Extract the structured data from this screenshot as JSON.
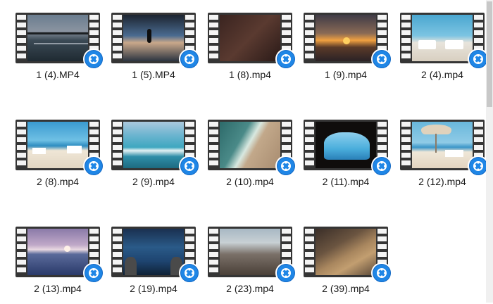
{
  "files": [
    {
      "name": "1 (4).MP4",
      "scene": "pier-sunset"
    },
    {
      "name": "1 (5).MP4",
      "scene": "person-dusk"
    },
    {
      "name": "1 (8).mp4",
      "scene": "dark-sand"
    },
    {
      "name": "1 (9).mp4",
      "scene": "orange-sunset"
    },
    {
      "name": "2 (4).mp4",
      "scene": "sunbeds"
    },
    {
      "name": "2 (8).mp4",
      "scene": "beach-chairs"
    },
    {
      "name": "2 (9).mp4",
      "scene": "turquoise-waves"
    },
    {
      "name": "2 (10).mp4",
      "scene": "aerial-shore"
    },
    {
      "name": "2 (11).mp4",
      "scene": "sea-cave"
    },
    {
      "name": "2 (12).mp4",
      "scene": "beach-umbrella"
    },
    {
      "name": "2 (13).mp4",
      "scene": "purple-sunset"
    },
    {
      "name": "2 (19).mp4",
      "scene": "feet-in-water"
    },
    {
      "name": "2 (23).mp4",
      "scene": "pebbles"
    },
    {
      "name": "2 (39).mp4",
      "scene": "sand-dusk"
    }
  ],
  "badge_icon": "video-player-icon",
  "colors": {
    "badge": "#1f86e6",
    "film": "#353535",
    "selection": "#cce8ff"
  }
}
